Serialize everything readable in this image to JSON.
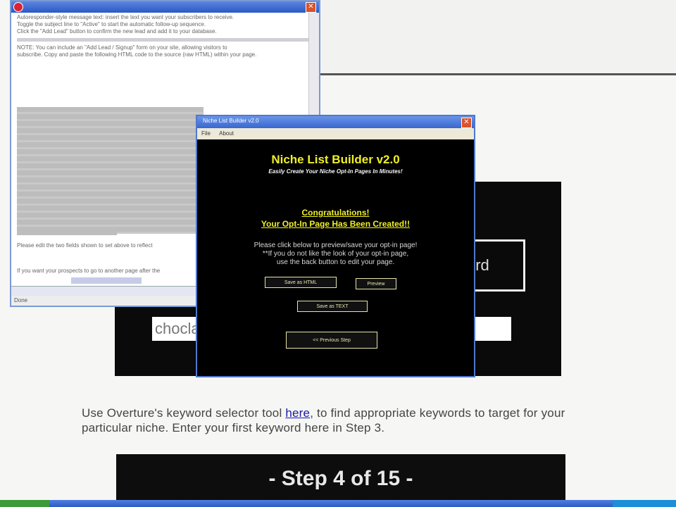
{
  "background_page": {
    "keyword_label": "ord",
    "keyword_input_value": "chocla",
    "paragraph": {
      "before_link": "Use Overture's  keyword selector tool ",
      "link_text": "here",
      "after_link": ", to find appropriate keywords to target for your particular niche. Enter your first keyword here in Step 3."
    },
    "step_banner": "- Step 4 of 15 -"
  },
  "email_window": {
    "body_lines": [
      "Autoresponder-style message text: insert the text you want your subscribers to receive.",
      "Toggle the subject line to \"Active\" to start the automatic follow-up sequence.",
      "Click the \"Add Lead\" button to confirm the new lead and add it to your database.",
      "NOTE: You can include an \"Add Lead / Signup\" form on your site, allowing visitors to",
      "subscribe. Copy and paste the following HTML code to the source (raw HTML) within your page."
    ],
    "note_para": "Please edit the two fields shown to set above to reflect",
    "redirect_para": "If you want your prospects to go to another page after the",
    "status_text": "Done"
  },
  "nlb_window": {
    "title": "Niche List Builder v2.0",
    "menu": [
      "File",
      "About"
    ],
    "heading": "Niche List Builder v2.0",
    "tagline": "Easily Create Your Niche Opt-In Pages In Minutes!",
    "congrats": "Congratulations!",
    "created": "Your Opt-In Page Has Been Created!!",
    "instructions": [
      "Please click below to preview/save your opt-in page!",
      "**If you do not like the look of your opt-in page,",
      "use the back button to edit your page."
    ],
    "buttons": {
      "save_html": "Save as HTML",
      "preview": "Preview",
      "save_text": "Save as TEXT",
      "previous": "<< Previous Step"
    }
  },
  "colors": {
    "heading_yellow": "#f0f028",
    "xp_title_blue": "#3767cf",
    "dialog_bg": "#000000"
  }
}
